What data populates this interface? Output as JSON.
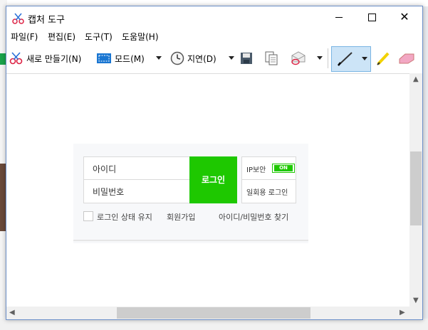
{
  "window": {
    "title": "캡처 도구"
  },
  "menu": [
    "파일(F)",
    "편집(E)",
    "도구(T)",
    "도움말(H)"
  ],
  "toolbar": {
    "new_label": "새로 만들기(N)",
    "mode_label": "모드(M)",
    "delay_label": "지연(D)"
  },
  "capture": {
    "id_placeholder": "아이디",
    "pw_placeholder": "비밀번호",
    "login_button": "로그인",
    "ip_security": "IP보안",
    "toggle_on": "ON",
    "one_time_login": "일회용 로그인",
    "keep_login": "로그인 상태 유지",
    "join": "회원가입",
    "find_account": "아이디/비밀번호 찾기"
  },
  "colors": {
    "accent_green": "#1ec800",
    "window_border": "#6b8fc9",
    "pen_highlight": "#cce4f7"
  }
}
